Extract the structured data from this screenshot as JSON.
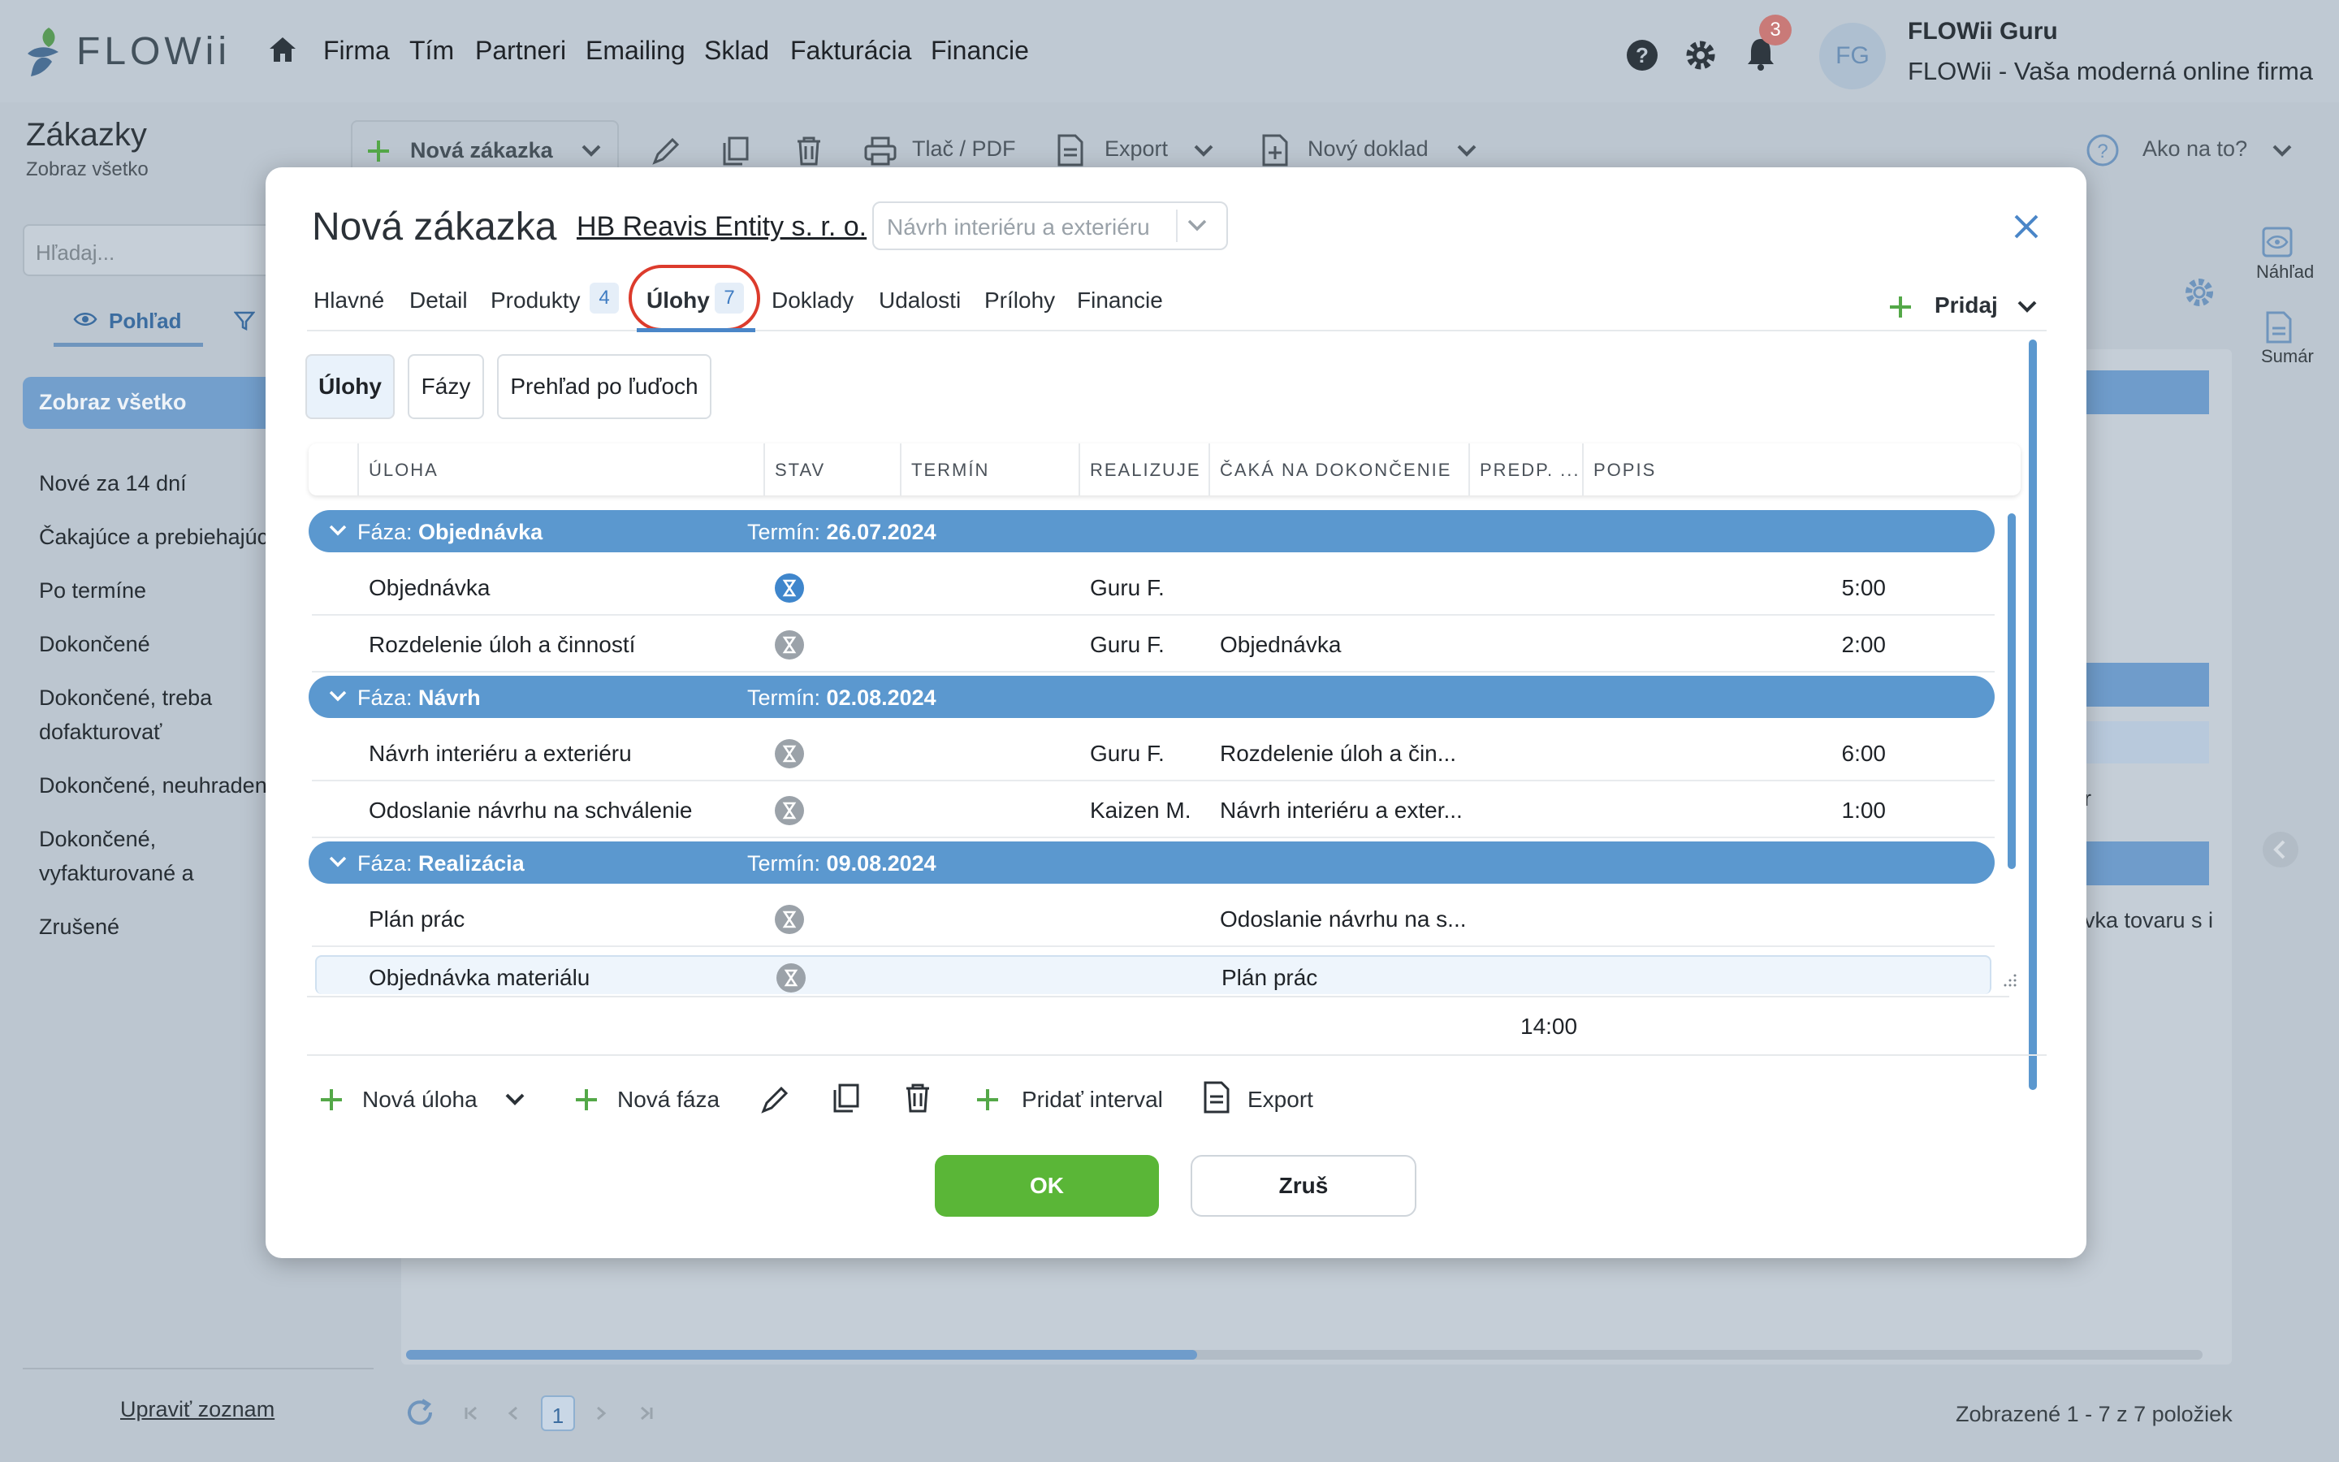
{
  "app": {
    "logo_text": "FLOWii",
    "menu": [
      "Firma",
      "Tím",
      "Partneri",
      "Emailing",
      "Sklad",
      "Fakturácia",
      "Financie"
    ],
    "notifications_count": "3",
    "avatar_initials": "FG",
    "user_name": "FLOWii Guru",
    "user_subtitle": "FLOWii - Vaša moderná online firma"
  },
  "page": {
    "title": "Zákazky",
    "subtitle": "Zobraz všetko",
    "toolbar": {
      "new_label": "Nová zákazka",
      "print_label": "Tlač / PDF",
      "export_label": "Export",
      "new_doc_label": "Nový doklad",
      "help_label": "Ako na to?"
    },
    "search_placeholder": "Hľadaj...",
    "view_tab": "Pohľad",
    "selected_filter": "Zobraz všetko",
    "filters": [
      "Nové za 14 dní",
      "Čakajúce a prebiehajúce",
      "Po termíne",
      "Dokončené",
      "Dokončené, treba dofakturovať",
      "Dokončené, neuhradené",
      "Dokončené, vyfakturované a zaplatené",
      "Zrušené"
    ],
    "edit_list": "Upraviť zoznam",
    "right_rail": {
      "preview": "Náhľad",
      "summary": "Sumár"
    },
    "bg_fragments": {
      "r": "r",
      "tovar": "vka tovaru s i"
    },
    "pager_page": "1",
    "footer_count": "Zobrazené 1 - 7 z 7 položiek"
  },
  "dialog": {
    "title": "Nová zákazka",
    "company": "HB Reavis Entity s. r. o.",
    "select_placeholder": "Návrh interiéru a exteriéru",
    "tabs": {
      "main": "Hlavné",
      "detail": "Detail",
      "products": "Produkty",
      "products_count": "4",
      "tasks": "Úlohy",
      "tasks_count": "7",
      "documents": "Doklady",
      "events": "Udalosti",
      "attachments": "Prílohy",
      "finance": "Financie"
    },
    "add_label": "Pridaj",
    "subtabs": {
      "tasks": "Úlohy",
      "phases": "Fázy",
      "people": "Prehľad po ľuďoch"
    },
    "columns": {
      "task": "ÚLOHA",
      "status": "STAV",
      "deadline": "TERMÍN",
      "assignee": "REALIZUJE",
      "waits": "ČAKÁ NA DOKONČENIE",
      "estimate": "PREDP. ...",
      "description": "POPIS"
    },
    "phase_prefix": "Fáza:",
    "term_prefix": "Termín:",
    "phases": [
      {
        "name": "Objednávka",
        "term": "26.07.2024"
      },
      {
        "name": "Návrh",
        "term": "02.08.2024"
      },
      {
        "name": "Realizácia",
        "term": "09.08.2024"
      }
    ],
    "rows": [
      {
        "task": "Objednávka",
        "assignee": "Guru F.",
        "waits": "",
        "estimate": "5:00",
        "status": "in-progress"
      },
      {
        "task": "Rozdelenie úloh a činností",
        "assignee": "Guru F.",
        "waits": "Objednávka",
        "estimate": "2:00",
        "status": "waiting"
      },
      {
        "task": "Návrh interiéru a exteriéru",
        "assignee": "Guru F.",
        "waits": "Rozdelenie úloh a čin...",
        "estimate": "6:00",
        "status": "waiting"
      },
      {
        "task": "Odoslanie návrhu na schválenie",
        "assignee": "Kaizen M.",
        "waits": "Návrh interiéru a exter...",
        "estimate": "1:00",
        "status": "waiting"
      },
      {
        "task": "Plán prác",
        "assignee": "",
        "waits": "Odoslanie návrhu na s...",
        "estimate": "",
        "status": "waiting"
      },
      {
        "task": "Objednávka materiálu",
        "assignee": "",
        "waits": "Plán prác",
        "estimate": "",
        "status": "waiting"
      }
    ],
    "total_estimate": "14:00",
    "actions": {
      "new_task": "Nová úloha",
      "new_phase": "Nová fáza",
      "add_interval": "Pridať interval",
      "export": "Export"
    },
    "ok_label": "OK",
    "cancel_label": "Zruš"
  },
  "colors": {
    "accent": "#5b98cf",
    "ok": "#5ab637",
    "highlight": "#dc3b2c",
    "logo_green": "#4ea64a",
    "logo_blue": "#3b79c0"
  }
}
